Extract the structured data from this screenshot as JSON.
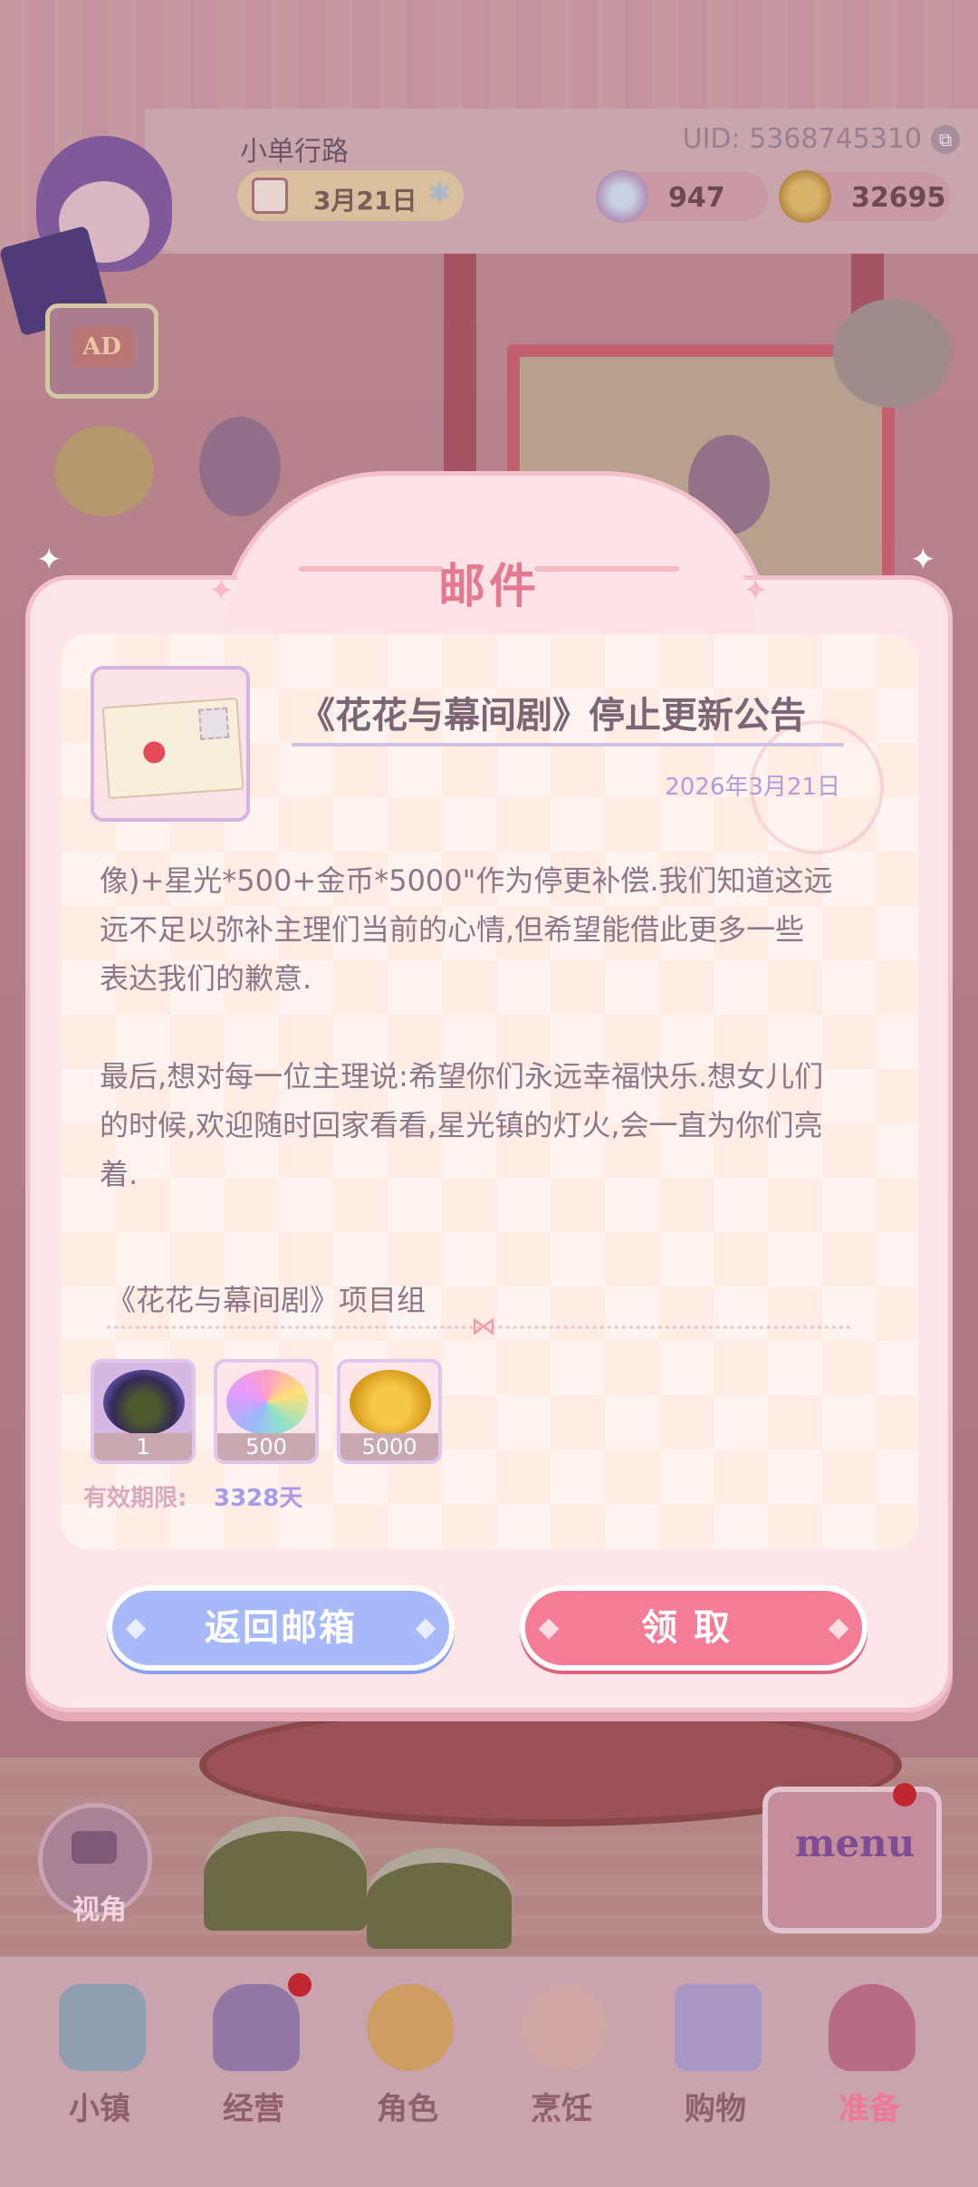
{
  "hud": {
    "player_name": "小单行路",
    "uid": "UID: 5368745310",
    "date": "3月21日",
    "stars": "947",
    "coins": "32695",
    "ad_label": "AD"
  },
  "mail": {
    "window_title": "邮件",
    "title": "《花花与幕间剧》停止更新公告",
    "date": "2026年3月21日",
    "body_lines": [
      "像)+星光*500+金币*5000\"作为停更补偿.我们知道这远",
      "远不足以弥补主理们当前的心情,但希望能借此更多一些",
      "表达我们的歉意.",
      "",
      "最后,想对每一位主理说:希望你们永远幸福快乐.想女儿们",
      "的时候,欢迎随时回家看看,星光镇的灯火,会一直为你们亮",
      "着."
    ],
    "signature": "《花花与幕间剧》项目组",
    "rewards": [
      {
        "icon": "cat-costume-icon",
        "qty": "1"
      },
      {
        "icon": "rainbow-star-icon",
        "qty": "500"
      },
      {
        "icon": "gold-coins-icon",
        "qty": "5000"
      }
    ],
    "expiry_label": "有效期限:",
    "expiry_value": "3328天",
    "back_button": "返回邮箱",
    "claim_button": "领取"
  },
  "side": {
    "view_label": "视角",
    "menu_label": "menu"
  },
  "nav": {
    "items": [
      {
        "label": "小镇",
        "icon": "town-map-icon"
      },
      {
        "label": "经营",
        "icon": "top-hat-icon"
      },
      {
        "label": "角色",
        "icon": "character-icon"
      },
      {
        "label": "烹饪",
        "icon": "cake-icon"
      },
      {
        "label": "购物",
        "icon": "shopping-bag-icon"
      },
      {
        "label": "准备",
        "icon": "basket-icon"
      }
    ],
    "active_index": 5
  },
  "colors": {
    "accent_pink": "#f47d95",
    "accent_blue": "#a8b9fa",
    "title_pink": "#e5798f",
    "date_purple": "#b29bdc"
  }
}
